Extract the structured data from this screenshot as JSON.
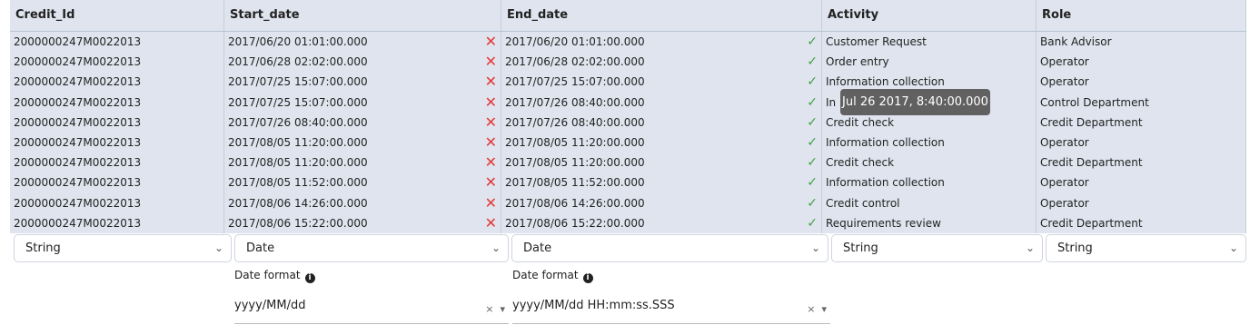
{
  "columns": [
    "Credit_Id",
    "Start_date",
    "End_date",
    "Activity",
    "Role"
  ],
  "rows": [
    [
      "2000000247M0022013",
      "2017/06/20 01:01:00.000",
      "2017/06/20 01:01:00.000",
      "Customer Request",
      "Bank Advisor"
    ],
    [
      "2000000247M0022013",
      "2017/06/28 02:02:00.000",
      "2017/06/28 02:02:00.000",
      "Order entry",
      "Operator"
    ],
    [
      "2000000247M0022013",
      "2017/07/25 15:07:00.000",
      "2017/07/25 15:07:00.000",
      "Information collection",
      "Operator"
    ],
    [
      "2000000247M0022013",
      "2017/07/25 15:07:00.000",
      "2017/07/26 08:40:00.000",
      "In",
      "Control Department"
    ],
    [
      "2000000247M0022013",
      "2017/07/26 08:40:00.000",
      "2017/07/26 08:40:00.000",
      "Credit check",
      "Credit Department"
    ],
    [
      "2000000247M0022013",
      "2017/08/05 11:20:00.000",
      "2017/08/05 11:20:00.000",
      "Information collection",
      "Operator"
    ],
    [
      "2000000247M0022013",
      "2017/08/05 11:20:00.000",
      "2017/08/05 11:20:00.000",
      "Credit check",
      "Credit Department"
    ],
    [
      "2000000247M0022013",
      "2017/08/05 11:52:00.000",
      "2017/08/05 11:52:00.000",
      "Information collection",
      "Operator"
    ],
    [
      "2000000247M0022013",
      "2017/08/06 14:26:00.000",
      "2017/08/06 14:26:00.000",
      "Credit control",
      "Operator"
    ],
    [
      "2000000247M0022013",
      "2017/08/06 15:22:00.000",
      "2017/08/06 15:22:00.000",
      "Requirements review",
      "Credit Department"
    ]
  ],
  "start_date_validity_icon": "red-x-icon",
  "end_date_validity_icon": "green-check-icon",
  "type_selects": [
    "String",
    "Date",
    "Date",
    "String",
    "String"
  ],
  "date_format": {
    "label": "Date format",
    "start_value": "yyyy/MM/dd",
    "end_value": "yyyy/MM/dd HH:mm:ss.SSS"
  },
  "tooltip": "Jul 26 2017, 8:40:00.000",
  "colors": {
    "grid_bg": "#dfe4ee",
    "invalid": "#e53935",
    "valid": "#43a047"
  }
}
